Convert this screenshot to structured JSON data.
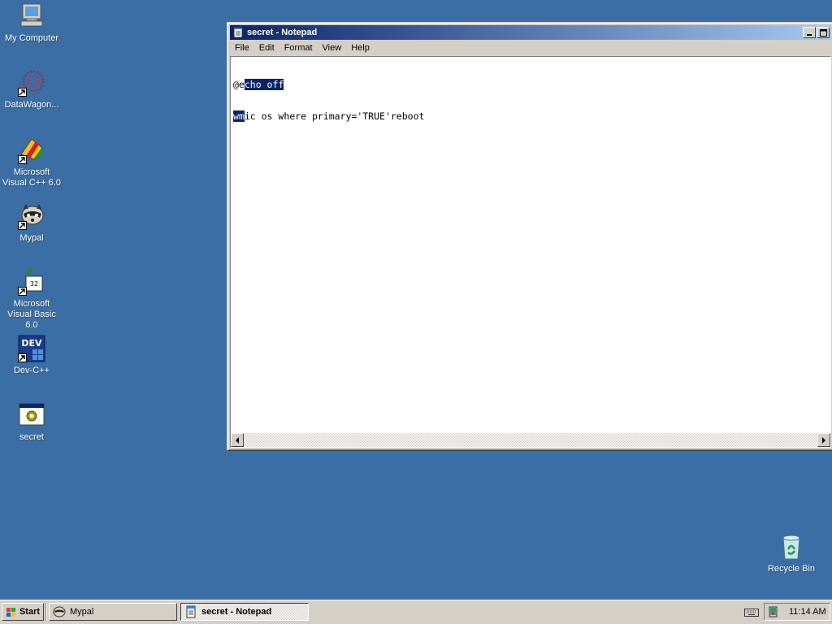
{
  "desktop": {
    "background_color": "#3a6ea5",
    "icons": [
      {
        "label": "My Computer",
        "icon": "my-computer-icon"
      },
      {
        "label": "DataWagon...",
        "icon": "datawagon-icon"
      },
      {
        "label": "Microsoft Visual C++ 6.0",
        "icon": "visual-cpp-icon"
      },
      {
        "label": "Mypal",
        "icon": "mypal-raccoon-icon"
      },
      {
        "label": "Microsoft Visual Basic 6.0",
        "icon": "visual-basic-icon"
      },
      {
        "label": "Dev-C++",
        "icon": "dev-cpp-icon"
      },
      {
        "label": "secret",
        "icon": "batch-file-icon"
      },
      {
        "label": "Recycle Bin",
        "icon": "recycle-bin-icon"
      }
    ]
  },
  "notepad": {
    "title": "secret - Notepad",
    "menu": [
      "File",
      "Edit",
      "Format",
      "View",
      "Help"
    ],
    "lines": [
      {
        "before": "@e",
        "selected": "cho off",
        "after": ""
      },
      {
        "before": "",
        "selected": "wm",
        "after": "ic os where primary='TRUE'reboot"
      }
    ],
    "selection_color": "#0a246a"
  },
  "taskbar": {
    "start_label": "Start",
    "tasks": [
      {
        "label": "Mypal",
        "active": false
      },
      {
        "label": "secret - Notepad",
        "active": true
      }
    ],
    "clock": "11:14 AM"
  }
}
